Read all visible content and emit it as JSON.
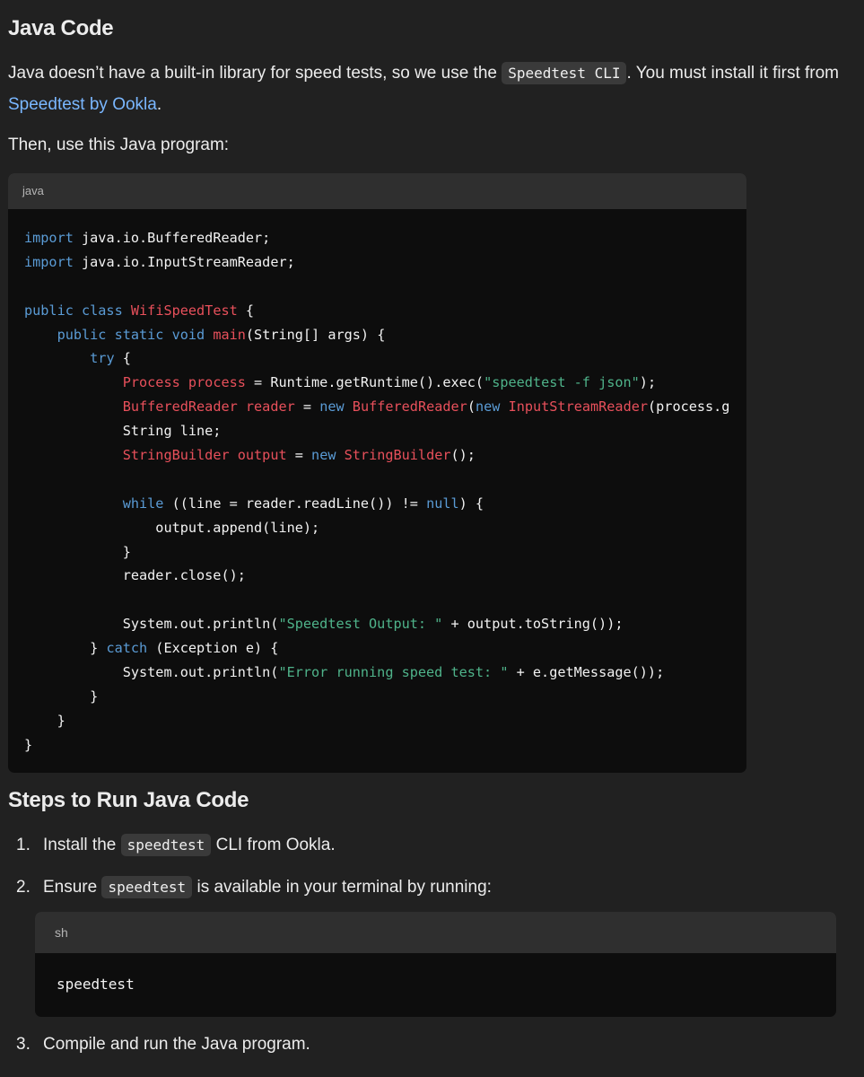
{
  "section1": {
    "title": "Java Code",
    "intro_before": "Java doesn’t have a built-in library for speed tests, so we use the ",
    "intro_code": "Speedtest CLI",
    "intro_after": ". You must install it first from ",
    "intro_link": "Speedtest by Ookla",
    "intro_end": ".",
    "then": "Then, use this Java program:"
  },
  "java_block": {
    "language": "java",
    "lines": [
      [
        {
          "t": "import",
          "c": "kw"
        },
        {
          "t": " java.io.BufferedReader;"
        }
      ],
      [
        {
          "t": "import",
          "c": "kw"
        },
        {
          "t": " java.io.InputStreamReader;"
        }
      ],
      [],
      [
        {
          "t": "public class",
          "c": "kw"
        },
        {
          "t": " "
        },
        {
          "t": "WifiSpeedTest",
          "c": "cls"
        },
        {
          "t": " {"
        }
      ],
      [
        {
          "t": "    "
        },
        {
          "t": "public static void",
          "c": "kw"
        },
        {
          "t": " "
        },
        {
          "t": "main",
          "c": "cls"
        },
        {
          "t": "(String[] args) {"
        }
      ],
      [
        {
          "t": "        "
        },
        {
          "t": "try",
          "c": "kw"
        },
        {
          "t": " {"
        }
      ],
      [
        {
          "t": "            "
        },
        {
          "t": "Process process",
          "c": "cls"
        },
        {
          "t": " = Runtime.getRuntime().exec("
        },
        {
          "t": "\"speedtest -f json\"",
          "c": "str"
        },
        {
          "t": ");"
        }
      ],
      [
        {
          "t": "            "
        },
        {
          "t": "BufferedReader reader",
          "c": "cls"
        },
        {
          "t": " = "
        },
        {
          "t": "new",
          "c": "kw"
        },
        {
          "t": " "
        },
        {
          "t": "BufferedReader",
          "c": "cls"
        },
        {
          "t": "("
        },
        {
          "t": "new",
          "c": "kw"
        },
        {
          "t": " "
        },
        {
          "t": "InputStreamReader",
          "c": "cls"
        },
        {
          "t": "(process.g"
        }
      ],
      [
        {
          "t": "            String line;"
        }
      ],
      [
        {
          "t": "            "
        },
        {
          "t": "StringBuilder output",
          "c": "cls"
        },
        {
          "t": " = "
        },
        {
          "t": "new",
          "c": "kw"
        },
        {
          "t": " "
        },
        {
          "t": "StringBuilder",
          "c": "cls"
        },
        {
          "t": "();"
        }
      ],
      [],
      [
        {
          "t": "            "
        },
        {
          "t": "while",
          "c": "kw"
        },
        {
          "t": " ((line = reader.readLine()) != "
        },
        {
          "t": "null",
          "c": "kw"
        },
        {
          "t": ") {"
        }
      ],
      [
        {
          "t": "                output.append(line);"
        }
      ],
      [
        {
          "t": "            }"
        }
      ],
      [
        {
          "t": "            reader.close();"
        }
      ],
      [],
      [
        {
          "t": "            System.out.println("
        },
        {
          "t": "\"Speedtest Output: \"",
          "c": "str"
        },
        {
          "t": " + output.toString());"
        }
      ],
      [
        {
          "t": "        } "
        },
        {
          "t": "catch",
          "c": "kw"
        },
        {
          "t": " (Exception e) {"
        }
      ],
      [
        {
          "t": "            System.out.println("
        },
        {
          "t": "\"Error running speed test: \"",
          "c": "str"
        },
        {
          "t": " + e.getMessage());"
        }
      ],
      [
        {
          "t": "        }"
        }
      ],
      [
        {
          "t": "    }"
        }
      ],
      [
        {
          "t": "}"
        }
      ]
    ]
  },
  "section2": {
    "title": "Steps to Run Java Code",
    "step1": {
      "num": "1.",
      "before": "Install the ",
      "code": "speedtest",
      "after": " CLI from Ookla."
    },
    "step2": {
      "num": "2.",
      "before": "Ensure ",
      "code": "speedtest",
      "after": " is available in your terminal by running:"
    },
    "step3": {
      "num": "3.",
      "text": "Compile and run the Java program."
    }
  },
  "sh_block": {
    "language": "sh",
    "code": "speedtest"
  },
  "colors": {
    "background": "#212121",
    "code_bg": "#0d0d0d",
    "code_header": "#2f2f2f",
    "keyword": "#5a9bd5",
    "class_name": "#e8505b",
    "string": "#4fb38a",
    "link": "#7ab7ff"
  }
}
